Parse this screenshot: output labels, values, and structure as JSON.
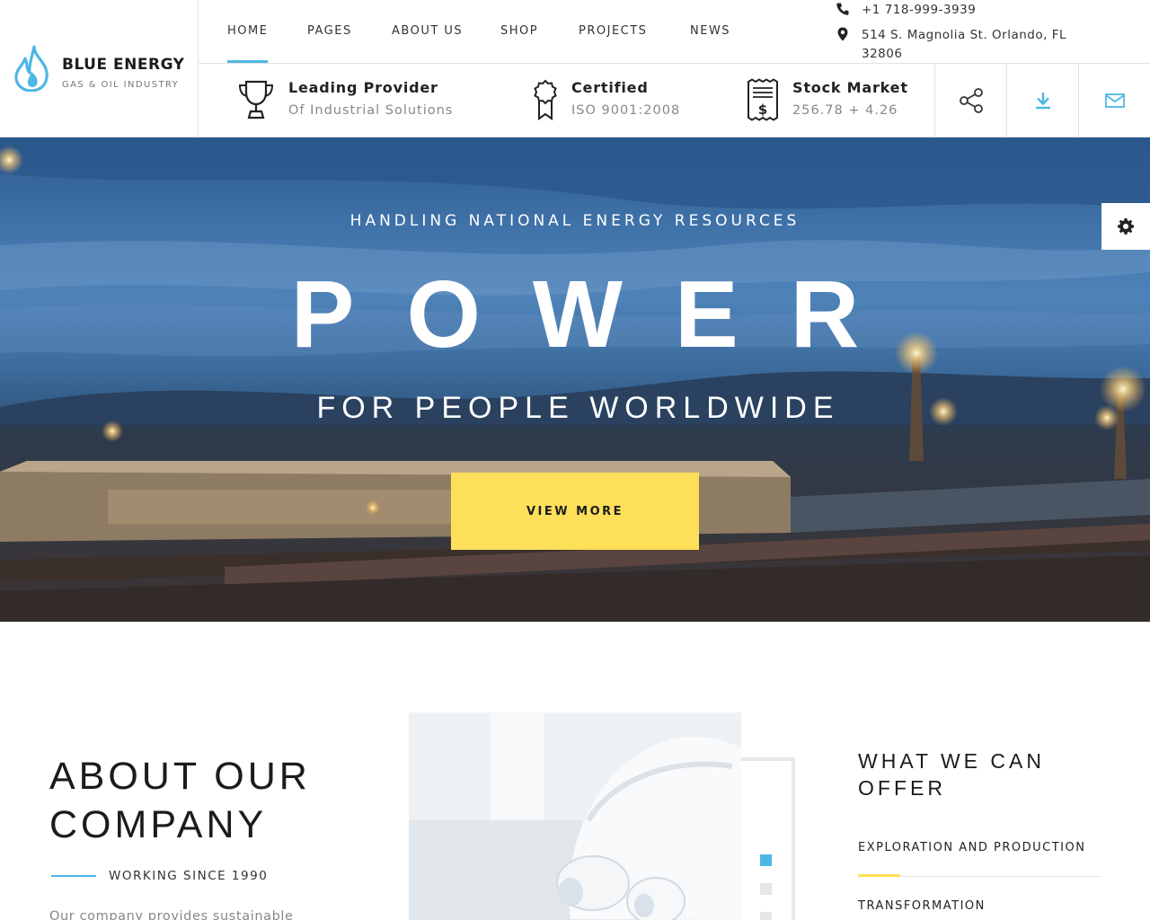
{
  "brand": {
    "name": "BLUE ENERGY",
    "tagline": "GAS & OIL INDUSTRY",
    "accent_color": "#4db7e5",
    "highlight_color": "#fedf5a"
  },
  "nav": {
    "items": [
      {
        "label": "HOME",
        "active": true
      },
      {
        "label": "PAGES",
        "active": false
      },
      {
        "label": "ABOUT US",
        "active": false
      },
      {
        "label": "SHOP",
        "active": false
      },
      {
        "label": "PROJECTS",
        "active": false
      },
      {
        "label": "NEWS",
        "active": false
      }
    ]
  },
  "contact": {
    "phone": "+1 718-999-3939",
    "address_line1": "514 S. Magnolia St. Orlando, FL",
    "address_line2": "32806",
    "phone_icon": "phone-icon",
    "address_icon": "map-pin-icon"
  },
  "info": [
    {
      "title": "Leading Provider",
      "subtitle": "Of Industrial Solutions",
      "icon": "trophy-icon"
    },
    {
      "title": "Certified",
      "subtitle": "ISO 9001:2008",
      "icon": "award-ribbon-icon"
    },
    {
      "title": "Stock Market",
      "subtitle": "256.78 + 4.26",
      "icon": "receipt-dollar-icon"
    }
  ],
  "actions": [
    {
      "name": "share",
      "icon": "share-icon"
    },
    {
      "name": "download",
      "icon": "download-icon"
    },
    {
      "name": "mail",
      "icon": "mail-icon"
    }
  ],
  "hero": {
    "kicker": "HANDLING NATIONAL ENERGY RESOURCES",
    "title": "POWER",
    "tagline": "FOR PEOPLE WORLDWIDE",
    "button_label": "VIEW MORE"
  },
  "settings": {
    "icon": "gear-icon"
  },
  "about": {
    "heading_line1": "ABOUT OUR",
    "heading_line2": "COMPANY",
    "since": "WORKING SINCE 1990",
    "text": "Our company provides sustainable"
  },
  "slider": {
    "active_index": 0,
    "count": 3
  },
  "offer": {
    "heading_line1": "WHAT WE CAN",
    "heading_line2": "OFFER",
    "items": [
      {
        "label": "EXPLORATION AND PRODUCTION",
        "active": true
      },
      {
        "label": "TRANSFORMATION",
        "active": false
      }
    ]
  }
}
